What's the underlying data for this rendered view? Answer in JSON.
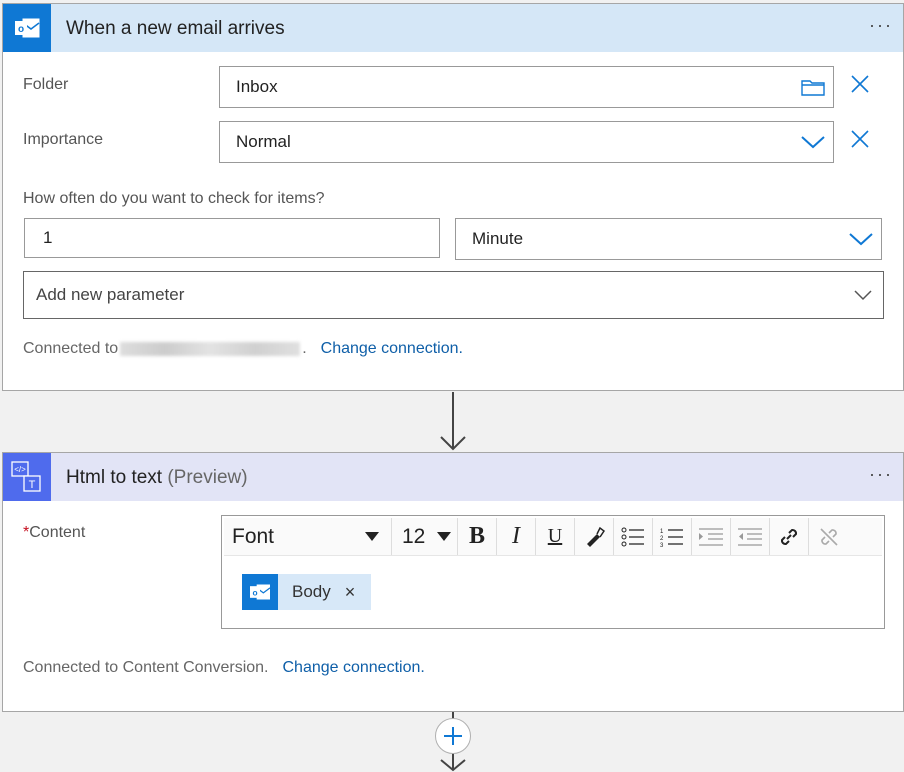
{
  "trigger": {
    "title": "When a new email arrives",
    "menu": "···",
    "folder": {
      "label": "Folder",
      "value": "Inbox"
    },
    "importance": {
      "label": "Importance",
      "value": "Normal"
    },
    "frequency": {
      "label": "How often do you want to check for items?",
      "interval": "1",
      "unit": "Minute"
    },
    "add_param": {
      "label": "Add new parameter"
    },
    "connection": {
      "prefix": "Connected to",
      "suffix": ".",
      "link": "Change connection."
    }
  },
  "action": {
    "title": "Html to text",
    "title_suffix": "(Preview)",
    "menu": "···",
    "content": {
      "required_mark": "*",
      "label": "Content"
    },
    "toolbar": {
      "font": "Font",
      "size": "12"
    },
    "token": {
      "label": "Body",
      "remove": "×"
    },
    "connection": {
      "text": "Connected to Content Conversion.",
      "link": "Change connection."
    }
  },
  "colors": {
    "outlook_blue": "#0f78d4",
    "conversion_purple": "#4f6bed",
    "link": "#0f5fa8",
    "trigger_header": "#d5e7f7",
    "action_header": "#e2e4f6"
  },
  "icons": [
    "outlook-icon",
    "folder-icon",
    "clear-icon",
    "chevron-down-icon",
    "html-to-text-icon",
    "bold-icon",
    "italic-icon",
    "underline-icon",
    "highlighter-icon",
    "bulleted-list-icon",
    "numbered-list-icon",
    "indent-icon",
    "outdent-icon",
    "link-icon",
    "unlink-icon",
    "plus-icon",
    "arrow-down-icon"
  ]
}
